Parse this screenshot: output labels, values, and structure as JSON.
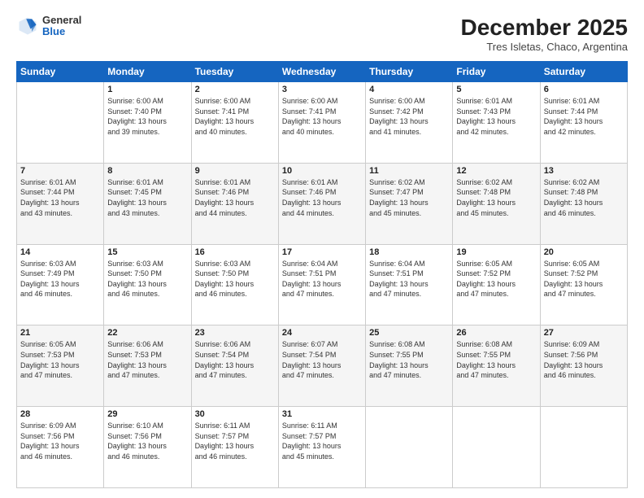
{
  "header": {
    "logo": {
      "general": "General",
      "blue": "Blue"
    },
    "title": "December 2025",
    "subtitle": "Tres Isletas, Chaco, Argentina"
  },
  "calendar": {
    "days": [
      "Sunday",
      "Monday",
      "Tuesday",
      "Wednesday",
      "Thursday",
      "Friday",
      "Saturday"
    ],
    "weeks": [
      [
        {
          "day": "",
          "sunrise": "",
          "sunset": "",
          "daylight": ""
        },
        {
          "day": "1",
          "sunrise": "Sunrise: 6:00 AM",
          "sunset": "Sunset: 7:40 PM",
          "daylight": "Daylight: 13 hours and 39 minutes."
        },
        {
          "day": "2",
          "sunrise": "Sunrise: 6:00 AM",
          "sunset": "Sunset: 7:41 PM",
          "daylight": "Daylight: 13 hours and 40 minutes."
        },
        {
          "day": "3",
          "sunrise": "Sunrise: 6:00 AM",
          "sunset": "Sunset: 7:41 PM",
          "daylight": "Daylight: 13 hours and 40 minutes."
        },
        {
          "day": "4",
          "sunrise": "Sunrise: 6:00 AM",
          "sunset": "Sunset: 7:42 PM",
          "daylight": "Daylight: 13 hours and 41 minutes."
        },
        {
          "day": "5",
          "sunrise": "Sunrise: 6:01 AM",
          "sunset": "Sunset: 7:43 PM",
          "daylight": "Daylight: 13 hours and 42 minutes."
        },
        {
          "day": "6",
          "sunrise": "Sunrise: 6:01 AM",
          "sunset": "Sunset: 7:44 PM",
          "daylight": "Daylight: 13 hours and 42 minutes."
        }
      ],
      [
        {
          "day": "7",
          "sunrise": "Sunrise: 6:01 AM",
          "sunset": "Sunset: 7:44 PM",
          "daylight": "Daylight: 13 hours and 43 minutes."
        },
        {
          "day": "8",
          "sunrise": "Sunrise: 6:01 AM",
          "sunset": "Sunset: 7:45 PM",
          "daylight": "Daylight: 13 hours and 43 minutes."
        },
        {
          "day": "9",
          "sunrise": "Sunrise: 6:01 AM",
          "sunset": "Sunset: 7:46 PM",
          "daylight": "Daylight: 13 hours and 44 minutes."
        },
        {
          "day": "10",
          "sunrise": "Sunrise: 6:01 AM",
          "sunset": "Sunset: 7:46 PM",
          "daylight": "Daylight: 13 hours and 44 minutes."
        },
        {
          "day": "11",
          "sunrise": "Sunrise: 6:02 AM",
          "sunset": "Sunset: 7:47 PM",
          "daylight": "Daylight: 13 hours and 45 minutes."
        },
        {
          "day": "12",
          "sunrise": "Sunrise: 6:02 AM",
          "sunset": "Sunset: 7:48 PM",
          "daylight": "Daylight: 13 hours and 45 minutes."
        },
        {
          "day": "13",
          "sunrise": "Sunrise: 6:02 AM",
          "sunset": "Sunset: 7:48 PM",
          "daylight": "Daylight: 13 hours and 46 minutes."
        }
      ],
      [
        {
          "day": "14",
          "sunrise": "Sunrise: 6:03 AM",
          "sunset": "Sunset: 7:49 PM",
          "daylight": "Daylight: 13 hours and 46 minutes."
        },
        {
          "day": "15",
          "sunrise": "Sunrise: 6:03 AM",
          "sunset": "Sunset: 7:50 PM",
          "daylight": "Daylight: 13 hours and 46 minutes."
        },
        {
          "day": "16",
          "sunrise": "Sunrise: 6:03 AM",
          "sunset": "Sunset: 7:50 PM",
          "daylight": "Daylight: 13 hours and 46 minutes."
        },
        {
          "day": "17",
          "sunrise": "Sunrise: 6:04 AM",
          "sunset": "Sunset: 7:51 PM",
          "daylight": "Daylight: 13 hours and 47 minutes."
        },
        {
          "day": "18",
          "sunrise": "Sunrise: 6:04 AM",
          "sunset": "Sunset: 7:51 PM",
          "daylight": "Daylight: 13 hours and 47 minutes."
        },
        {
          "day": "19",
          "sunrise": "Sunrise: 6:05 AM",
          "sunset": "Sunset: 7:52 PM",
          "daylight": "Daylight: 13 hours and 47 minutes."
        },
        {
          "day": "20",
          "sunrise": "Sunrise: 6:05 AM",
          "sunset": "Sunset: 7:52 PM",
          "daylight": "Daylight: 13 hours and 47 minutes."
        }
      ],
      [
        {
          "day": "21",
          "sunrise": "Sunrise: 6:05 AM",
          "sunset": "Sunset: 7:53 PM",
          "daylight": "Daylight: 13 hours and 47 minutes."
        },
        {
          "day": "22",
          "sunrise": "Sunrise: 6:06 AM",
          "sunset": "Sunset: 7:53 PM",
          "daylight": "Daylight: 13 hours and 47 minutes."
        },
        {
          "day": "23",
          "sunrise": "Sunrise: 6:06 AM",
          "sunset": "Sunset: 7:54 PM",
          "daylight": "Daylight: 13 hours and 47 minutes."
        },
        {
          "day": "24",
          "sunrise": "Sunrise: 6:07 AM",
          "sunset": "Sunset: 7:54 PM",
          "daylight": "Daylight: 13 hours and 47 minutes."
        },
        {
          "day": "25",
          "sunrise": "Sunrise: 6:08 AM",
          "sunset": "Sunset: 7:55 PM",
          "daylight": "Daylight: 13 hours and 47 minutes."
        },
        {
          "day": "26",
          "sunrise": "Sunrise: 6:08 AM",
          "sunset": "Sunset: 7:55 PM",
          "daylight": "Daylight: 13 hours and 47 minutes."
        },
        {
          "day": "27",
          "sunrise": "Sunrise: 6:09 AM",
          "sunset": "Sunset: 7:56 PM",
          "daylight": "Daylight: 13 hours and 46 minutes."
        }
      ],
      [
        {
          "day": "28",
          "sunrise": "Sunrise: 6:09 AM",
          "sunset": "Sunset: 7:56 PM",
          "daylight": "Daylight: 13 hours and 46 minutes."
        },
        {
          "day": "29",
          "sunrise": "Sunrise: 6:10 AM",
          "sunset": "Sunset: 7:56 PM",
          "daylight": "Daylight: 13 hours and 46 minutes."
        },
        {
          "day": "30",
          "sunrise": "Sunrise: 6:11 AM",
          "sunset": "Sunset: 7:57 PM",
          "daylight": "Daylight: 13 hours and 46 minutes."
        },
        {
          "day": "31",
          "sunrise": "Sunrise: 6:11 AM",
          "sunset": "Sunset: 7:57 PM",
          "daylight": "Daylight: 13 hours and 45 minutes."
        },
        {
          "day": "",
          "sunrise": "",
          "sunset": "",
          "daylight": ""
        },
        {
          "day": "",
          "sunrise": "",
          "sunset": "",
          "daylight": ""
        },
        {
          "day": "",
          "sunrise": "",
          "sunset": "",
          "daylight": ""
        }
      ]
    ]
  }
}
